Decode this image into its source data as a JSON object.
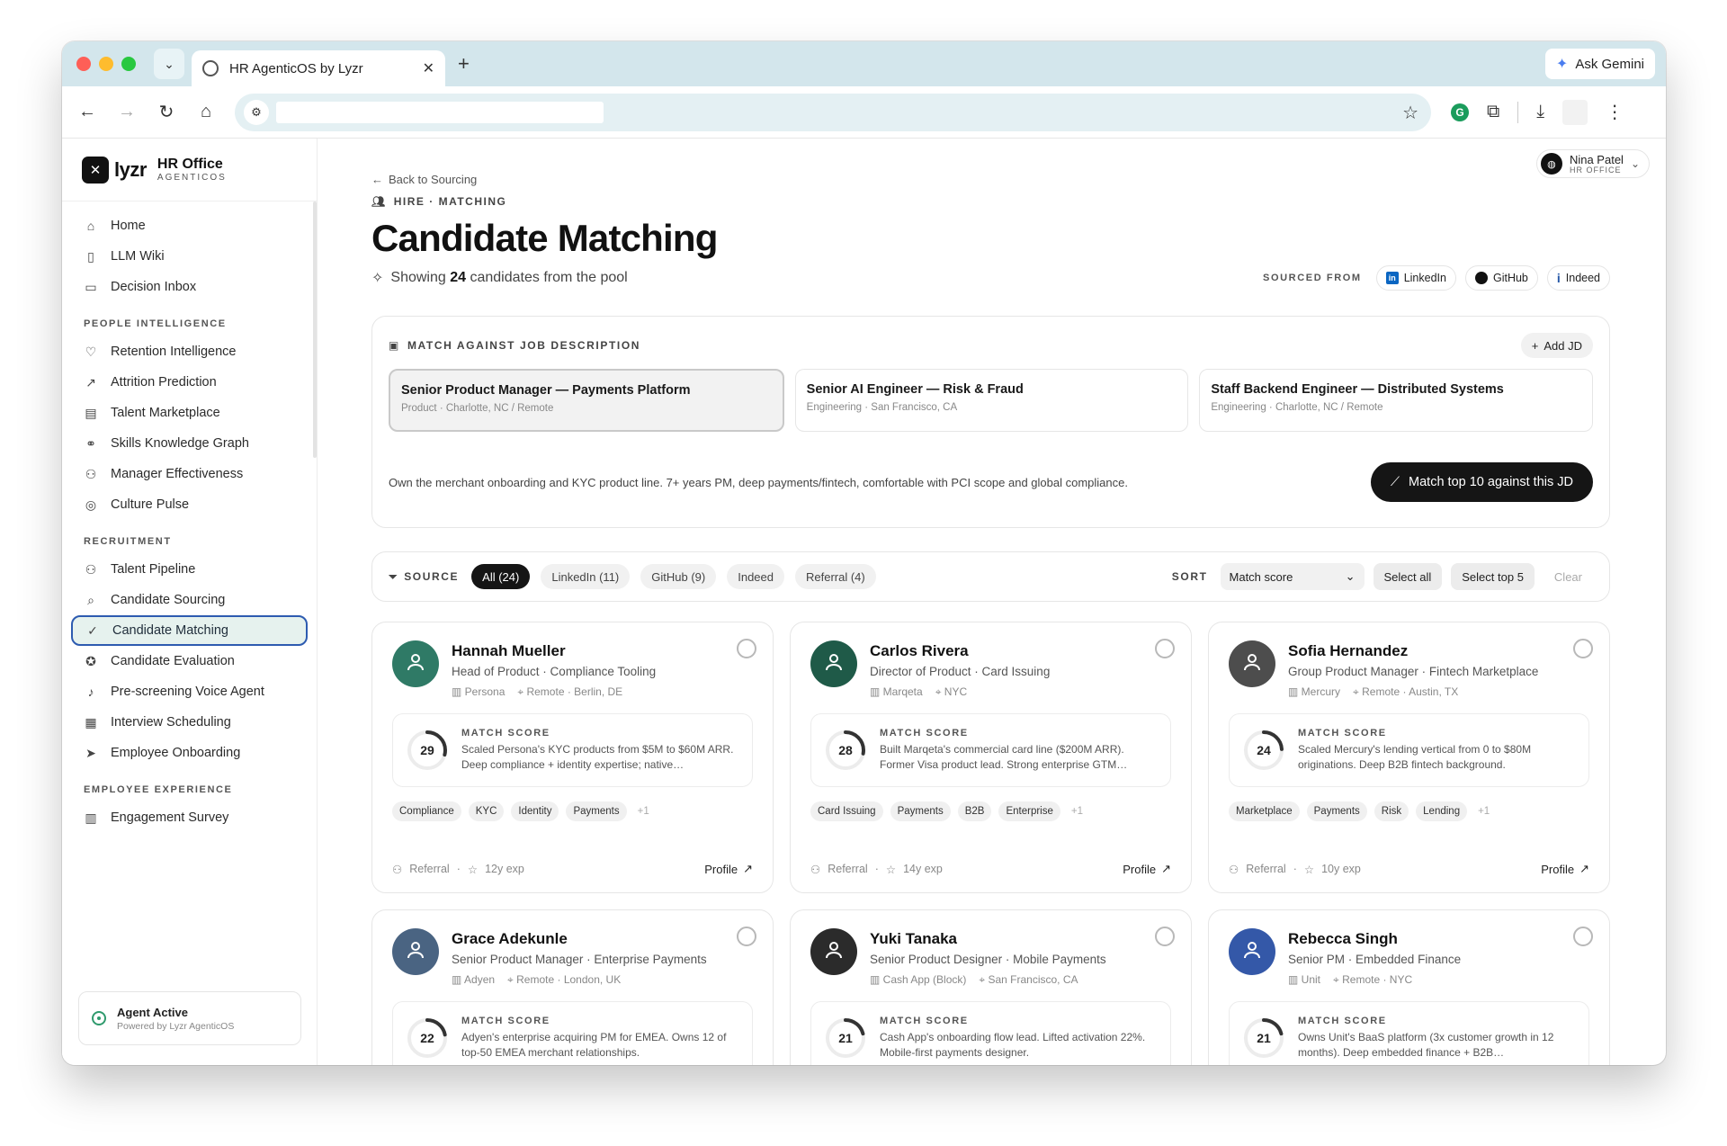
{
  "browser": {
    "tab_title": "HR AgenticOS by Lyzr",
    "gemini_label": "Ask Gemini"
  },
  "brand": {
    "logo_word": "lyzr",
    "title": "HR Office",
    "subtitle": "AGENTICOS"
  },
  "sidebar": {
    "top_items": [
      {
        "label": "Home",
        "icon": "home-icon"
      },
      {
        "label": "LLM Wiki",
        "icon": "book-icon"
      },
      {
        "label": "Decision Inbox",
        "icon": "inbox-icon"
      }
    ],
    "sections": [
      {
        "title": "PEOPLE INTELLIGENCE",
        "items": [
          {
            "label": "Retention Intelligence",
            "icon": "heart-icon"
          },
          {
            "label": "Attrition Prediction",
            "icon": "trend-icon"
          },
          {
            "label": "Talent Marketplace",
            "icon": "store-icon"
          },
          {
            "label": "Skills Knowledge Graph",
            "icon": "graph-icon"
          },
          {
            "label": "Manager Effectiveness",
            "icon": "users-icon"
          },
          {
            "label": "Culture Pulse",
            "icon": "pulse-icon"
          }
        ]
      },
      {
        "title": "RECRUITMENT",
        "items": [
          {
            "label": "Talent Pipeline",
            "icon": "users-icon"
          },
          {
            "label": "Candidate Sourcing",
            "icon": "search-icon"
          },
          {
            "label": "Candidate Matching",
            "icon": "user-check-icon",
            "active": true
          },
          {
            "label": "Candidate Evaluation",
            "icon": "award-icon"
          },
          {
            "label": "Pre-screening Voice Agent",
            "icon": "mic-icon"
          },
          {
            "label": "Interview Scheduling",
            "icon": "calendar-icon"
          },
          {
            "label": "Employee Onboarding",
            "icon": "send-icon"
          }
        ]
      },
      {
        "title": "EMPLOYEE EXPERIENCE",
        "items": [
          {
            "label": "Engagement Survey",
            "icon": "clipboard-icon"
          }
        ]
      }
    ],
    "agent": {
      "title": "Agent Active",
      "subtitle": "Powered by Lyzr AgenticOS"
    }
  },
  "user": {
    "name": "Nina Patel",
    "role": "HR OFFICE"
  },
  "header": {
    "back_label": "Back to Sourcing",
    "breadcrumb": "HIRE · MATCHING",
    "title": "Candidate Matching",
    "subtitle_prefix": "Showing",
    "subtitle_count": "24",
    "subtitle_suffix": "candidates from the pool",
    "sourced_label": "SOURCED FROM",
    "sources": [
      "LinkedIn",
      "GitHub",
      "Indeed"
    ]
  },
  "jd_panel": {
    "label": "MATCH AGAINST JOB DESCRIPTION",
    "add_label": "Add JD",
    "jobs": [
      {
        "title": "Senior Product Manager — Payments Platform",
        "meta": "Product · Charlotte, NC / Remote",
        "selected": true
      },
      {
        "title": "Senior AI Engineer — Risk & Fraud",
        "meta": "Engineering · San Francisco, CA",
        "selected": false
      },
      {
        "title": "Staff Backend Engineer — Distributed Systems",
        "meta": "Engineering · Charlotte, NC / Remote",
        "selected": false
      }
    ],
    "description": "Own the merchant onboarding and KYC product line. 7+ years PM, deep payments/fintech, comfortable with PCI scope and global compliance.",
    "match_button": "Match top 10 against this JD"
  },
  "filters": {
    "source_label": "SOURCE",
    "chips": [
      {
        "label": "All (24)",
        "active": true
      },
      {
        "label": "LinkedIn (11)",
        "active": false
      },
      {
        "label": "GitHub (9)",
        "active": false
      },
      {
        "label": "Indeed",
        "active": false
      },
      {
        "label": "Referral (4)",
        "active": false
      }
    ],
    "sort_label": "SORT",
    "sort_value": "Match score",
    "select_all": "Select all",
    "select_top": "Select top 5",
    "clear": "Clear"
  },
  "candidate_labels": {
    "match_score": "MATCH SCORE",
    "profile": "Profile"
  },
  "candidates": [
    {
      "name": "Hannah Mueller",
      "role": "Head of Product · Compliance Tooling",
      "company": "Persona",
      "location": "Remote · Berlin, DE",
      "score": "29",
      "score_pct": 29,
      "summary": "Scaled Persona's KYC products from $5M to $60M ARR. Deep compliance + identity expertise; native…",
      "tags": [
        "Compliance",
        "KYC",
        "Identity",
        "Payments"
      ],
      "more": "+1",
      "source": "Referral",
      "exp": "12y exp",
      "avatar_color": "#2f7a66"
    },
    {
      "name": "Carlos Rivera",
      "role": "Director of Product · Card Issuing",
      "company": "Marqeta",
      "location": "NYC",
      "score": "28",
      "score_pct": 28,
      "summary": "Built Marqeta's commercial card line ($200M ARR). Former Visa product lead. Strong enterprise GTM…",
      "tags": [
        "Card Issuing",
        "Payments",
        "B2B",
        "Enterprise"
      ],
      "more": "+1",
      "source": "Referral",
      "exp": "14y exp",
      "avatar_color": "#1f5a48"
    },
    {
      "name": "Sofia Hernandez",
      "role": "Group Product Manager · Fintech Marketplace",
      "company": "Mercury",
      "location": "Remote · Austin, TX",
      "score": "24",
      "score_pct": 24,
      "summary": "Scaled Mercury's lending vertical from 0 to $80M originations. Deep B2B fintech background.",
      "tags": [
        "Marketplace",
        "Payments",
        "Risk",
        "Lending"
      ],
      "more": "+1",
      "source": "Referral",
      "exp": "10y exp",
      "avatar_color": "#4d4d4d"
    },
    {
      "name": "Grace Adekunle",
      "role": "Senior Product Manager · Enterprise Payments",
      "company": "Adyen",
      "location": "Remote · London, UK",
      "score": "22",
      "score_pct": 22,
      "summary": "Adyen's enterprise acquiring PM for EMEA. Owns 12 of top-50 EMEA merchant relationships.",
      "tags": [],
      "more": "",
      "source": "",
      "exp": "",
      "avatar_color": "#4a6482"
    },
    {
      "name": "Yuki Tanaka",
      "role": "Senior Product Designer · Mobile Payments",
      "company": "Cash App (Block)",
      "location": "San Francisco, CA",
      "score": "21",
      "score_pct": 21,
      "summary": "Cash App's onboarding flow lead. Lifted activation 22%. Mobile-first payments designer.",
      "tags": [],
      "more": "",
      "source": "",
      "exp": "",
      "avatar_color": "#2b2b2b"
    },
    {
      "name": "Rebecca Singh",
      "role": "Senior PM · Embedded Finance",
      "company": "Unit",
      "location": "Remote · NYC",
      "score": "21",
      "score_pct": 21,
      "summary": "Owns Unit's BaaS platform (3x customer growth in 12 months). Deep embedded finance + B2B…",
      "tags": [],
      "more": "",
      "source": "",
      "exp": "",
      "avatar_color": "#3458a8"
    }
  ]
}
